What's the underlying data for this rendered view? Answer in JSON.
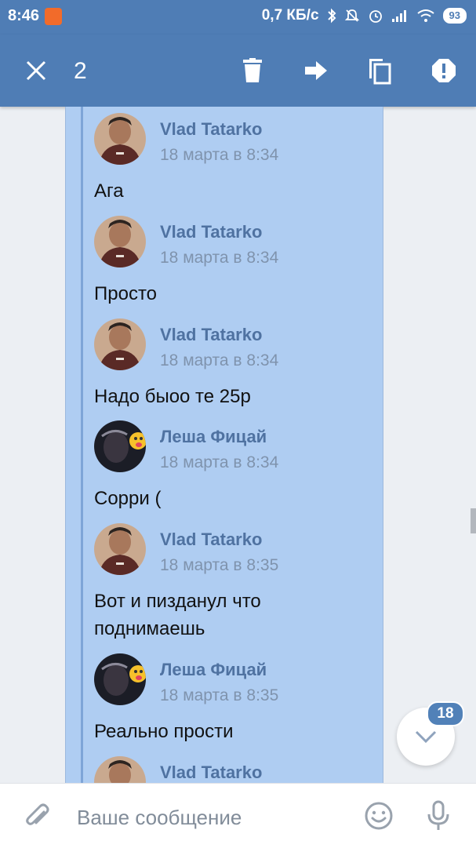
{
  "status_bar": {
    "time": "8:46",
    "speed": "0,7 КБ/с",
    "battery": "93"
  },
  "action_bar": {
    "selected_count": "2",
    "icons": [
      "close-icon",
      "delete-icon",
      "forward-icon",
      "copy-icon",
      "report-icon"
    ]
  },
  "messages": [
    {
      "author": "Vlad Tatarko",
      "date": "18 марта в 8:34",
      "text": "Ага",
      "avatar": "vlad"
    },
    {
      "author": "Vlad Tatarko",
      "date": "18 марта в 8:34",
      "text": "Просто",
      "avatar": "vlad"
    },
    {
      "author": "Vlad Tatarko",
      "date": "18 марта в 8:34",
      "text": "Надо  быоо те 25р",
      "avatar": "vlad"
    },
    {
      "author": "Леша Фицай",
      "date": "18 марта в 8:34",
      "text": "Сорри (",
      "avatar": "lesha"
    },
    {
      "author": "Vlad Tatarko",
      "date": "18 марта в 8:35",
      "text": "Вот и пизданул что поднимаешь",
      "avatar": "vlad"
    },
    {
      "author": "Леша Фицай",
      "date": "18 марта в 8:35",
      "text": "Реально прости",
      "avatar": "lesha"
    },
    {
      "author": "Vlad Tatarko",
      "date": "",
      "text": "",
      "avatar": "vlad"
    }
  ],
  "scroll_down": {
    "badge": "18"
  },
  "input": {
    "placeholder": "Ваше сообщение"
  },
  "colors": {
    "header": "#4f7db5",
    "selection": "#afcdf2",
    "author": "#4f72a1",
    "badge": "#5181b8"
  }
}
